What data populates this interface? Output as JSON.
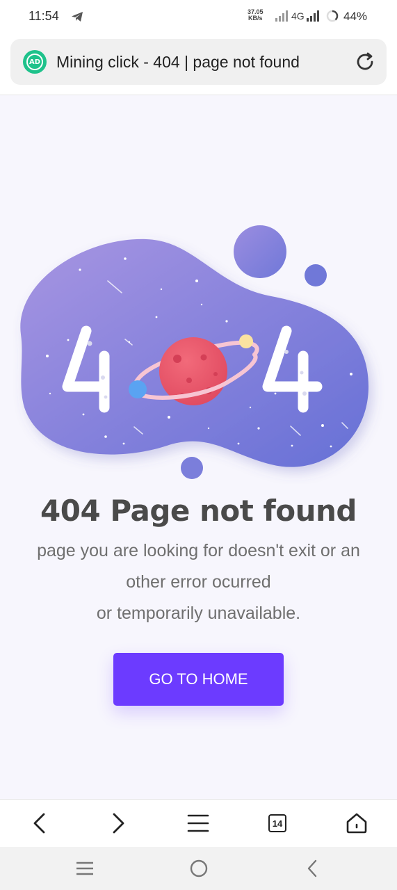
{
  "status_bar": {
    "time": "11:54",
    "net_speed_value": "37.05",
    "net_speed_unit": "KB/s",
    "network_type": "4G",
    "battery": "44%"
  },
  "browser": {
    "adblock_label": "AD",
    "page_title": "Mining click - 404 | page not found",
    "tab_count": "14"
  },
  "illustration": {
    "digit_left": "4",
    "digit_right": "4"
  },
  "error": {
    "title": "404 Page not found",
    "line1": "page you are looking for doesn't exit or an",
    "line2": "other error ocurred",
    "line3": "or temporarily unavailable.",
    "button_label": "GO TO HOME"
  },
  "colors": {
    "accent": "#6c3bff",
    "blob_start": "#a08fe0",
    "blob_end": "#6a6fd8",
    "planet": "#ee5a6c"
  },
  "icons": [
    "telegram-icon",
    "signal-icon",
    "battery-ring-icon",
    "adblock-icon",
    "reload-icon",
    "back-icon",
    "forward-icon",
    "menu-icon",
    "tabs-icon",
    "home-icon",
    "recents-icon",
    "home-circle-icon",
    "nav-back-icon"
  ]
}
